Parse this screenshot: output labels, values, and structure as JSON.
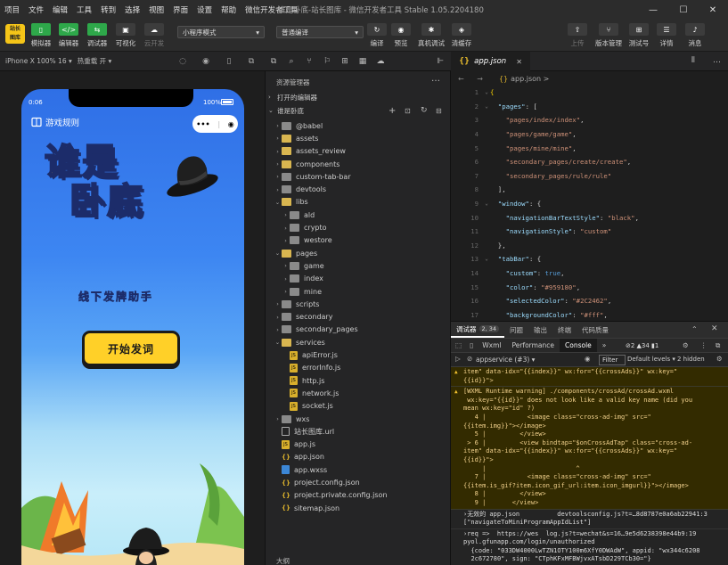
{
  "window": {
    "title": "谁是卧底-站长图库 - 微信开发者工具 Stable 1.05.2204180",
    "controls": {
      "minimize": "—",
      "maximize": "☐",
      "close": "✕"
    }
  },
  "menu": [
    "项目",
    "文件",
    "编辑",
    "工具",
    "转到",
    "选择",
    "视图",
    "界面",
    "设置",
    "帮助",
    "微信开发者工具"
  ],
  "toolbar": {
    "logo": "站长\n图库",
    "simulator": "模拟器",
    "editor": "编辑器",
    "debugger": "调试器",
    "visual": "可视化",
    "cloud": "云开发",
    "mode": "小程序模式",
    "compile_mode": "普通编译",
    "compile": "编译",
    "preview": "预览",
    "real_debug": "真机调试",
    "clear_cache": "清缓存",
    "upload": "上传",
    "version": "版本管理",
    "test": "测试号",
    "details": "详情",
    "messages": "消息"
  },
  "simulator": {
    "device": "iPhone X 100% 16",
    "hot_reload": "热重载 开",
    "status_time": "0:06",
    "status_battery": "100%",
    "game_rules": "游戏规则",
    "capsule_more": "•••",
    "capsule_close": "◉",
    "title_line1": "谁是",
    "title_line2": "卧底",
    "subtitle": "线下发牌助手",
    "start_button": "开始发词"
  },
  "explorer": {
    "title": "资源管理器",
    "open_editors": "打开的编辑器",
    "project": "谁是卧底",
    "outline": "大纲",
    "tree": [
      {
        "name": "@babel",
        "depth": 1,
        "kind": "folder",
        "arrow": "›"
      },
      {
        "name": "assets",
        "depth": 1,
        "kind": "folder-yellow",
        "arrow": "›"
      },
      {
        "name": "assets_review",
        "depth": 1,
        "kind": "folder-yellow",
        "arrow": "›"
      },
      {
        "name": "components",
        "depth": 1,
        "kind": "folder-yellow",
        "arrow": "›"
      },
      {
        "name": "custom-tab-bar",
        "depth": 1,
        "kind": "folder",
        "arrow": "›"
      },
      {
        "name": "devtools",
        "depth": 1,
        "kind": "folder",
        "arrow": "›"
      },
      {
        "name": "libs",
        "depth": 1,
        "kind": "folder-yellow",
        "arrow": "⌄"
      },
      {
        "name": "ald",
        "depth": 2,
        "kind": "folder",
        "arrow": "›"
      },
      {
        "name": "crypto",
        "depth": 2,
        "kind": "folder",
        "arrow": "›"
      },
      {
        "name": "westore",
        "depth": 2,
        "kind": "folder",
        "arrow": "›"
      },
      {
        "name": "pages",
        "depth": 1,
        "kind": "folder-yellow",
        "arrow": "⌄"
      },
      {
        "name": "game",
        "depth": 2,
        "kind": "folder",
        "arrow": "›"
      },
      {
        "name": "index",
        "depth": 2,
        "kind": "folder",
        "arrow": "›"
      },
      {
        "name": "mine",
        "depth": 2,
        "kind": "folder",
        "arrow": "›"
      },
      {
        "name": "scripts",
        "depth": 1,
        "kind": "folder",
        "arrow": "›"
      },
      {
        "name": "secondary",
        "depth": 1,
        "kind": "folder",
        "arrow": "›"
      },
      {
        "name": "secondary_pages",
        "depth": 1,
        "kind": "folder",
        "arrow": "›"
      },
      {
        "name": "services",
        "depth": 1,
        "kind": "folder-yellow",
        "arrow": "⌄"
      },
      {
        "name": "apiError.js",
        "depth": 2,
        "kind": "js",
        "arrow": ""
      },
      {
        "name": "errorInfo.js",
        "depth": 2,
        "kind": "js",
        "arrow": ""
      },
      {
        "name": "http.js",
        "depth": 2,
        "kind": "js",
        "arrow": ""
      },
      {
        "name": "network.js",
        "depth": 2,
        "kind": "js",
        "arrow": ""
      },
      {
        "name": "socket.js",
        "depth": 2,
        "kind": "js",
        "arrow": ""
      },
      {
        "name": "wxs",
        "depth": 1,
        "kind": "folder",
        "arrow": "›"
      },
      {
        "name": "站长图库.url",
        "depth": 1,
        "kind": "url",
        "arrow": ""
      },
      {
        "name": "app.js",
        "depth": 1,
        "kind": "js",
        "arrow": ""
      },
      {
        "name": "app.json",
        "depth": 1,
        "kind": "json",
        "arrow": ""
      },
      {
        "name": "app.wxss",
        "depth": 1,
        "kind": "wxss",
        "arrow": ""
      },
      {
        "name": "project.config.json",
        "depth": 1,
        "kind": "json",
        "arrow": ""
      },
      {
        "name": "project.private.config.json",
        "depth": 1,
        "kind": "json",
        "arrow": ""
      },
      {
        "name": "sitemap.json",
        "depth": 1,
        "kind": "json",
        "arrow": ""
      }
    ]
  },
  "editor": {
    "tab_name": "app.json",
    "tab_icon": "{}",
    "breadcrumb": "app.json >",
    "breadcrumb_nav": "← →",
    "lines": [
      {
        "n": "1",
        "fold": "⌄",
        "html": "<span class='br'>{</span>"
      },
      {
        "n": "2",
        "fold": "⌄",
        "html": "  <span class='pk'>\"pages\"</span><span class='p'>: [</span>"
      },
      {
        "n": "3",
        "fold": "",
        "html": "    <span class='s'>\"pages/index/index\"</span><span class='p'>,</span>"
      },
      {
        "n": "4",
        "fold": "",
        "html": "    <span class='s'>\"pages/game/game\"</span><span class='p'>,</span>"
      },
      {
        "n": "5",
        "fold": "",
        "html": "    <span class='s'>\"pages/mine/mine\"</span><span class='p'>,</span>"
      },
      {
        "n": "6",
        "fold": "",
        "html": "    <span class='s'>\"secondary_pages/create/create\"</span><span class='p'>,</span>"
      },
      {
        "n": "7",
        "fold": "",
        "html": "    <span class='s'>\"secondary_pages/rule/rule\"</span>"
      },
      {
        "n": "8",
        "fold": "",
        "html": "  <span class='p'>],</span>"
      },
      {
        "n": "9",
        "fold": "⌄",
        "html": "  <span class='pk'>\"window\"</span><span class='p'>: {</span>"
      },
      {
        "n": "10",
        "fold": "",
        "html": "    <span class='pk'>\"navigationBarTextStyle\"</span><span class='p'>: </span><span class='s'>\"black\"</span><span class='p'>,</span>"
      },
      {
        "n": "11",
        "fold": "",
        "html": "    <span class='pk'>\"navigationStyle\"</span><span class='p'>: </span><span class='s'>\"custom\"</span>"
      },
      {
        "n": "12",
        "fold": "",
        "html": "  <span class='p'>},</span>"
      },
      {
        "n": "13",
        "fold": "⌄",
        "html": "  <span class='pk'>\"tabBar\"</span><span class='p'>: {</span>"
      },
      {
        "n": "14",
        "fold": "",
        "html": "    <span class='pk'>\"custom\"</span><span class='p'>: </span><span class='b'>true</span><span class='p'>,</span>"
      },
      {
        "n": "15",
        "fold": "",
        "html": "    <span class='pk'>\"color\"</span><span class='p'>: </span><span class='s'>\"#959180\"</span><span class='p'>,</span>"
      },
      {
        "n": "16",
        "fold": "",
        "html": "    <span class='pk'>\"selectedColor\"</span><span class='p'>: </span><span class='s'>\"#2C2462\"</span><span class='p'>,</span>"
      },
      {
        "n": "17",
        "fold": "",
        "html": "    <span class='pk'>\"backgroundColor\"</span><span class='p'>: </span><span class='s'>\"#fff\"</span><span class='p'>,</span>"
      }
    ]
  },
  "debugger": {
    "tabs": [
      {
        "label": "调试器",
        "active": true
      },
      {
        "label": "问题",
        "active": false
      },
      {
        "label": "输出",
        "active": false
      },
      {
        "label": "终端",
        "active": false
      },
      {
        "label": "代码质量",
        "active": false
      }
    ],
    "badge": "2, 34",
    "devtools_tabs": [
      {
        "label": "Wxml",
        "active": false
      },
      {
        "label": "Performance",
        "active": false
      },
      {
        "label": "Console",
        "active": true
      },
      {
        "label": "»",
        "active": false
      }
    ],
    "counts": "⊘2 ▲34 ▮1",
    "context": "appservice (#3)",
    "filter": "Filter",
    "levels": "Default levels ▾",
    "hidden": "2 hidden",
    "log": [
      {
        "type": "warn",
        "text": "item\" data-idx=\"{{index}}\" wx:for=\"{{crossAds}}\" wx:key=\"\n{{id}}\">"
      },
      {
        "type": "warn",
        "text": "[WXML Runtime warning] ./components/crossAd/crossAd.wxml\n wx:key=\"{{id}}\" does not look like a valid key name (did you\nmean wx:key=\"id\" ?)\n   4 |           <image class=\"cross-ad-img\" src=\"\n{{item.img}}\"></image>\n   5 |         </view>\n > 6 |         <view bindtap=\"$onCrossAdTap\" class=\"cross-ad-\nitem\" data-idx=\"{{index}}\" wx:for=\"{{crossAds}}\" wx:key=\"\n{{id}}\">\n     |                        ^\n   7 |           <image class=\"cross-ad-img\" src=\"\n{{item.is_gif?item.icon_gif_url:item.icon_imgurl}}\"></image>\n   8 |         </view>\n   9 |       </view>"
      },
      {
        "type": "plain",
        "text": "›无效的 app.json          devtoolsconfig.js?t=…8d8787e0a6ab22941:3\n[\"navigateToMiniProgramAppIdList\"]"
      },
      {
        "type": "plain",
        "text": "›req =>  https://wes  log.js?t=wechat&s=16…9e5d6238398e44b9:19\npyol.gfunapp.com/login/unauthorized\n  {code: \"033DW4000LwTZN1OTY100m6XfY0DWAdW\", appid: \"wx344c6208\n  2c672780\", sign: \"CTphKFxMFBWjvxATsbD229TCb30=\"}"
      },
      {
        "type": "plain",
        "text": "›res =>  500 null 登  log.js?t=wechat&s=16…9e5d6238398e44b9:19"
      }
    ]
  },
  "colors": {
    "accent_green": "#2ea84a",
    "phone_sky_top": "#2f6fe6",
    "start_button": "#ffd028",
    "title_yellow": "#ffd93a",
    "warn_bg": "#332b00"
  }
}
